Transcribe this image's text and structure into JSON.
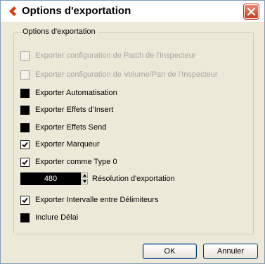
{
  "window": {
    "title": "Options d'exportation"
  },
  "group": {
    "title": "Options d'exportation"
  },
  "options": [
    {
      "label": "Exporter configuration de Patch de l'Inspecteur",
      "state": "disabled"
    },
    {
      "label": "Exporter configuration de Volume/Pan de l'Inspecteur",
      "state": "disabled"
    },
    {
      "label": "Exporter Automatisation",
      "state": "unchecked"
    },
    {
      "label": "Exporter Effets d'Insert",
      "state": "unchecked"
    },
    {
      "label": "Exporter Effets Send",
      "state": "unchecked"
    },
    {
      "label": "Exporter Marqueur",
      "state": "checked"
    },
    {
      "label": "Exporter comme Type 0",
      "state": "checked"
    }
  ],
  "resolution": {
    "value": "480",
    "label": "Résolution d'exportation"
  },
  "options_after": [
    {
      "label": "Exporter Intervalle entre Délimiteurs",
      "state": "checked"
    },
    {
      "label": "Inclure Délai",
      "state": "unchecked"
    }
  ],
  "buttons": {
    "ok": "OK",
    "cancel": "Annuler"
  },
  "icons": {
    "app": "cubase-arrow-icon",
    "close": "close-icon"
  },
  "colors": {
    "title_icon": "#d93a14",
    "close": "#c4401f",
    "face": "#ece9d8"
  }
}
